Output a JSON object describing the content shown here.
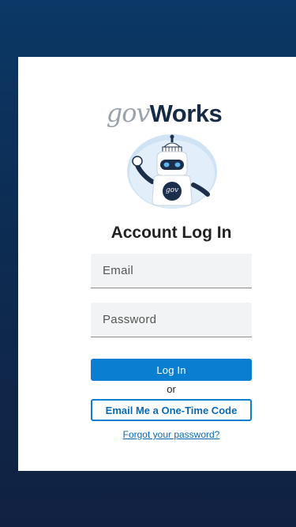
{
  "brand": {
    "logo_gov": "gov",
    "logo_works": "Works",
    "mascot_badge": "gov",
    "mascot_icon": "capitol-robot-icon"
  },
  "login": {
    "title": "Account Log In",
    "email_placeholder": "Email",
    "password_placeholder": "Password",
    "login_label": "Log In",
    "or_text": "or",
    "otc_label": "Email Me a One-Time Code",
    "forgot_label": "Forgot your password?"
  },
  "colors": {
    "background_top": "#0b3866",
    "background_bottom": "#112141",
    "primary": "#0a7fd2",
    "link": "#0a69b4",
    "brand_dark": "#152a44"
  }
}
